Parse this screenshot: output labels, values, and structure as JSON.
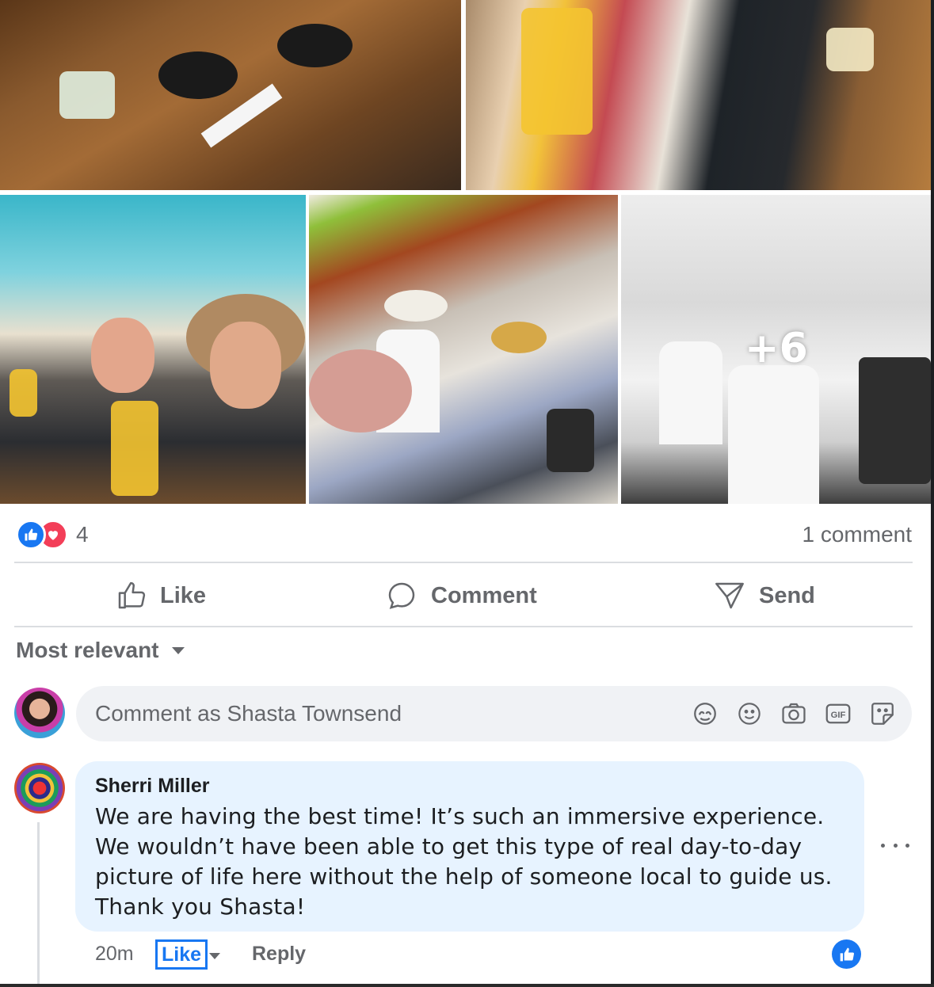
{
  "photos": {
    "items": [
      {
        "alt": "table-drinks"
      },
      {
        "alt": "women-drinks"
      },
      {
        "alt": "selfie-cocktails"
      },
      {
        "alt": "group-street"
      },
      {
        "alt": "clinic-visit"
      }
    ],
    "more_count": "+6"
  },
  "reactions": {
    "icons": [
      "like-icon",
      "love-icon"
    ],
    "count": "4",
    "comments_count": "1 comment"
  },
  "actions": {
    "like": "Like",
    "comment": "Comment",
    "send": "Send"
  },
  "sort": {
    "label": "Most relevant"
  },
  "composer": {
    "placeholder": "Comment as Shasta Townsend",
    "tools": [
      "avatar-sticker-icon",
      "emoji-icon",
      "camera-icon",
      "gif-icon",
      "sticker-icon"
    ]
  },
  "comment": {
    "author": "Sherri Miller",
    "text": "We are having the best time! It’s such an immersive experience. We wouldn’t have been able to get this type of real day-to-day picture of life here without the help of someone local to guide us. Thank you Shasta!",
    "time": "20m",
    "like_label": "Like",
    "reply_label": "Reply"
  },
  "colors": {
    "accent": "#1877f2",
    "love": "#f33e58",
    "bubble": "#e7f3ff",
    "muted_text": "#65676b"
  }
}
